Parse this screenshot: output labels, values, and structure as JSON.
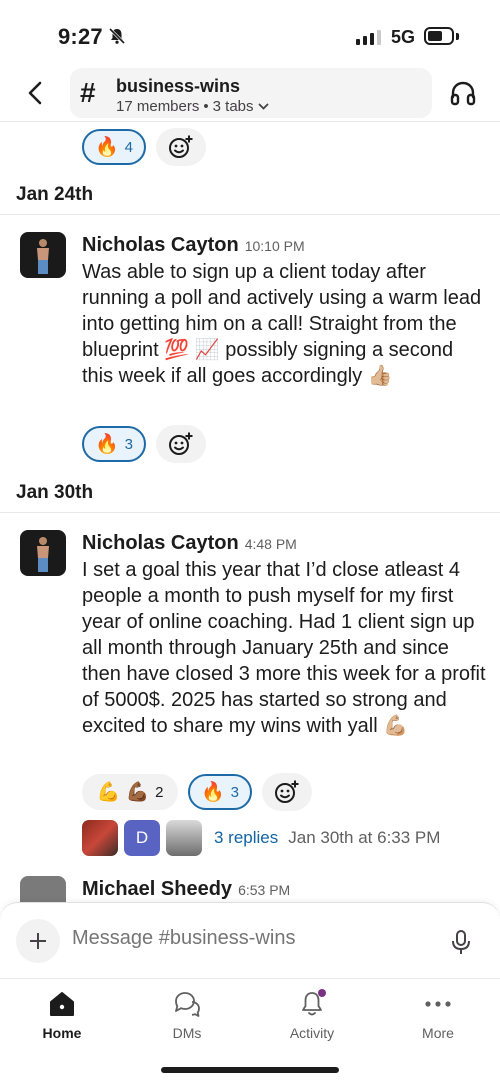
{
  "status_bar": {
    "time": "9:27",
    "network": "5G"
  },
  "header": {
    "channel_name": "business-wins",
    "members": "17 members",
    "separator": "•",
    "tabs": "3 tabs"
  },
  "top_reactions": {
    "fire_count": "4"
  },
  "days": [
    {
      "label": "Jan 24th"
    },
    {
      "label": "Jan 30th"
    }
  ],
  "messages": [
    {
      "author": "Nicholas Cayton",
      "time": "10:10 PM",
      "text": "Was able to sign up a client today after running a poll and actively using a warm lead into getting him on a call! Straight from the blueprint 💯 📈 possibly signing a second this week if all goes accordingly 👍🏼",
      "reactions": [
        {
          "emoji": "🔥",
          "count": "3"
        }
      ]
    },
    {
      "author": "Nicholas Cayton",
      "time": "4:48 PM",
      "text": "I set a goal this year that I’d close atleast 4 people a month to push myself for my first year of online coaching. Had 1 client sign up all month through January 25th and since then have closed 3 more this week for a profit of 5000$. 2025 has started so strong and excited to share my wins with yall 💪🏼",
      "reactions": [
        {
          "emoji": "💪 💪🏾",
          "count": "2"
        },
        {
          "emoji": "🔥",
          "count": "3"
        }
      ],
      "thread": {
        "avatar_letter": "D",
        "replies": "3 replies",
        "last_reply": "Jan 30th at 6:33 PM"
      }
    },
    {
      "author": "Michael Sheedy",
      "time": "6:53 PM"
    }
  ],
  "composer": {
    "placeholder": "Message #business-wins"
  },
  "tabbar": {
    "home": "Home",
    "dms": "DMs",
    "activity": "Activity",
    "more": "More"
  },
  "colors": {
    "accent_blue": "#1d6aa7",
    "link_blue": "#1264a3",
    "activity_dot": "#7c3085"
  }
}
